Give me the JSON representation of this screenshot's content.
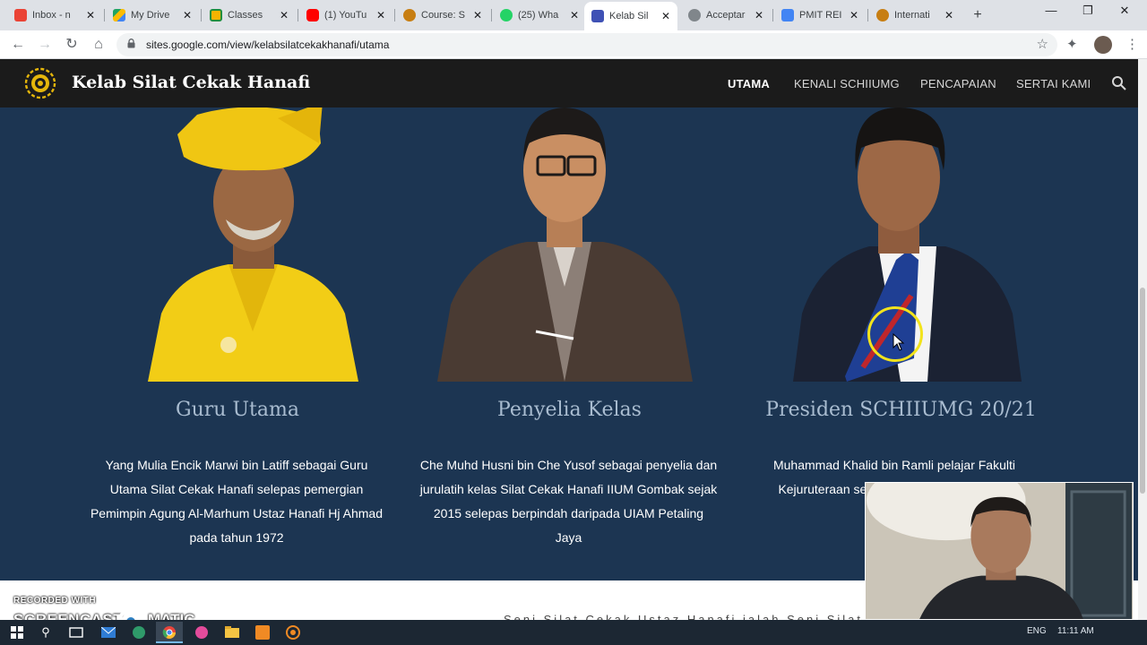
{
  "browser": {
    "tabs": [
      {
        "title": "Inbox - n",
        "favicon": "gmail-icon",
        "color": "#ea4335"
      },
      {
        "title": "My Drive",
        "favicon": "drive-icon",
        "color": "#fbbc04"
      },
      {
        "title": "Classes",
        "favicon": "classroom-icon",
        "color": "#f5b400"
      },
      {
        "title": "(1) YouTu",
        "favicon": "youtube-icon",
        "color": "#ff0000"
      },
      {
        "title": "Course: S",
        "favicon": "moodle-icon",
        "color": "#c77e12"
      },
      {
        "title": "(25) Wha",
        "favicon": "whatsapp-icon",
        "color": "#25d366"
      },
      {
        "title": "Kelab Sil",
        "favicon": "google-sites-icon",
        "color": "#3f51b5",
        "active": true
      },
      {
        "title": "Acceptar",
        "favicon": "globe-icon",
        "color": "#80868b"
      },
      {
        "title": "PMIT REI",
        "favicon": "google-docs-icon",
        "color": "#4285f4"
      },
      {
        "title": "Internati",
        "favicon": "moodle-icon",
        "color": "#c77e12"
      }
    ],
    "url": "sites.google.com/view/kelabsilatcekakhanafi/utama"
  },
  "site": {
    "title": "Kelab Silat Cekak Hanafi",
    "nav": [
      "UTAMA",
      "KENALI SCHIIUMG",
      "PENCAPAIAN",
      "SERTAI KAMI"
    ],
    "active_nav": "UTAMA",
    "accent": "#1c3552",
    "header_bg": "#1b1b1b"
  },
  "people": [
    {
      "name": "Guru Utama",
      "description": "Yang Mulia Encik Marwi bin Latiff sebagai Guru Utama Silat Cekak Hanafi selepas pemergian Pemimpin Agung Al-Marhum Ustaz Hanafi Hj Ahmad pada tahun 1972"
    },
    {
      "name": "Penyelia Kelas",
      "description": "Che Muhd Husni bin Che Yusof sebagai penyelia dan jurulatih kelas Silat Cekak Hanafi IIUM Gombak sejak 2015 selepas berpindah daripada UIAM Petaling Jaya"
    },
    {
      "name": "Presiden SCHIIUMG 20/21",
      "description": "Muhammad Khalid bin Ramli pelajar Fakulti Kejuruteraan seba... Cekak Hanafi IIUM..."
    }
  ],
  "intro_snippet": "Seni Silat Cekak Ustaz Hanafi ialah Seni Silat Cekak",
  "watermark": {
    "recorded_with": "RECORDED WITH",
    "brand_left": "SCREENCAST",
    "brand_right": "MATIC"
  },
  "taskbar": {
    "lang": "ENG",
    "time": "11:11 AM"
  }
}
